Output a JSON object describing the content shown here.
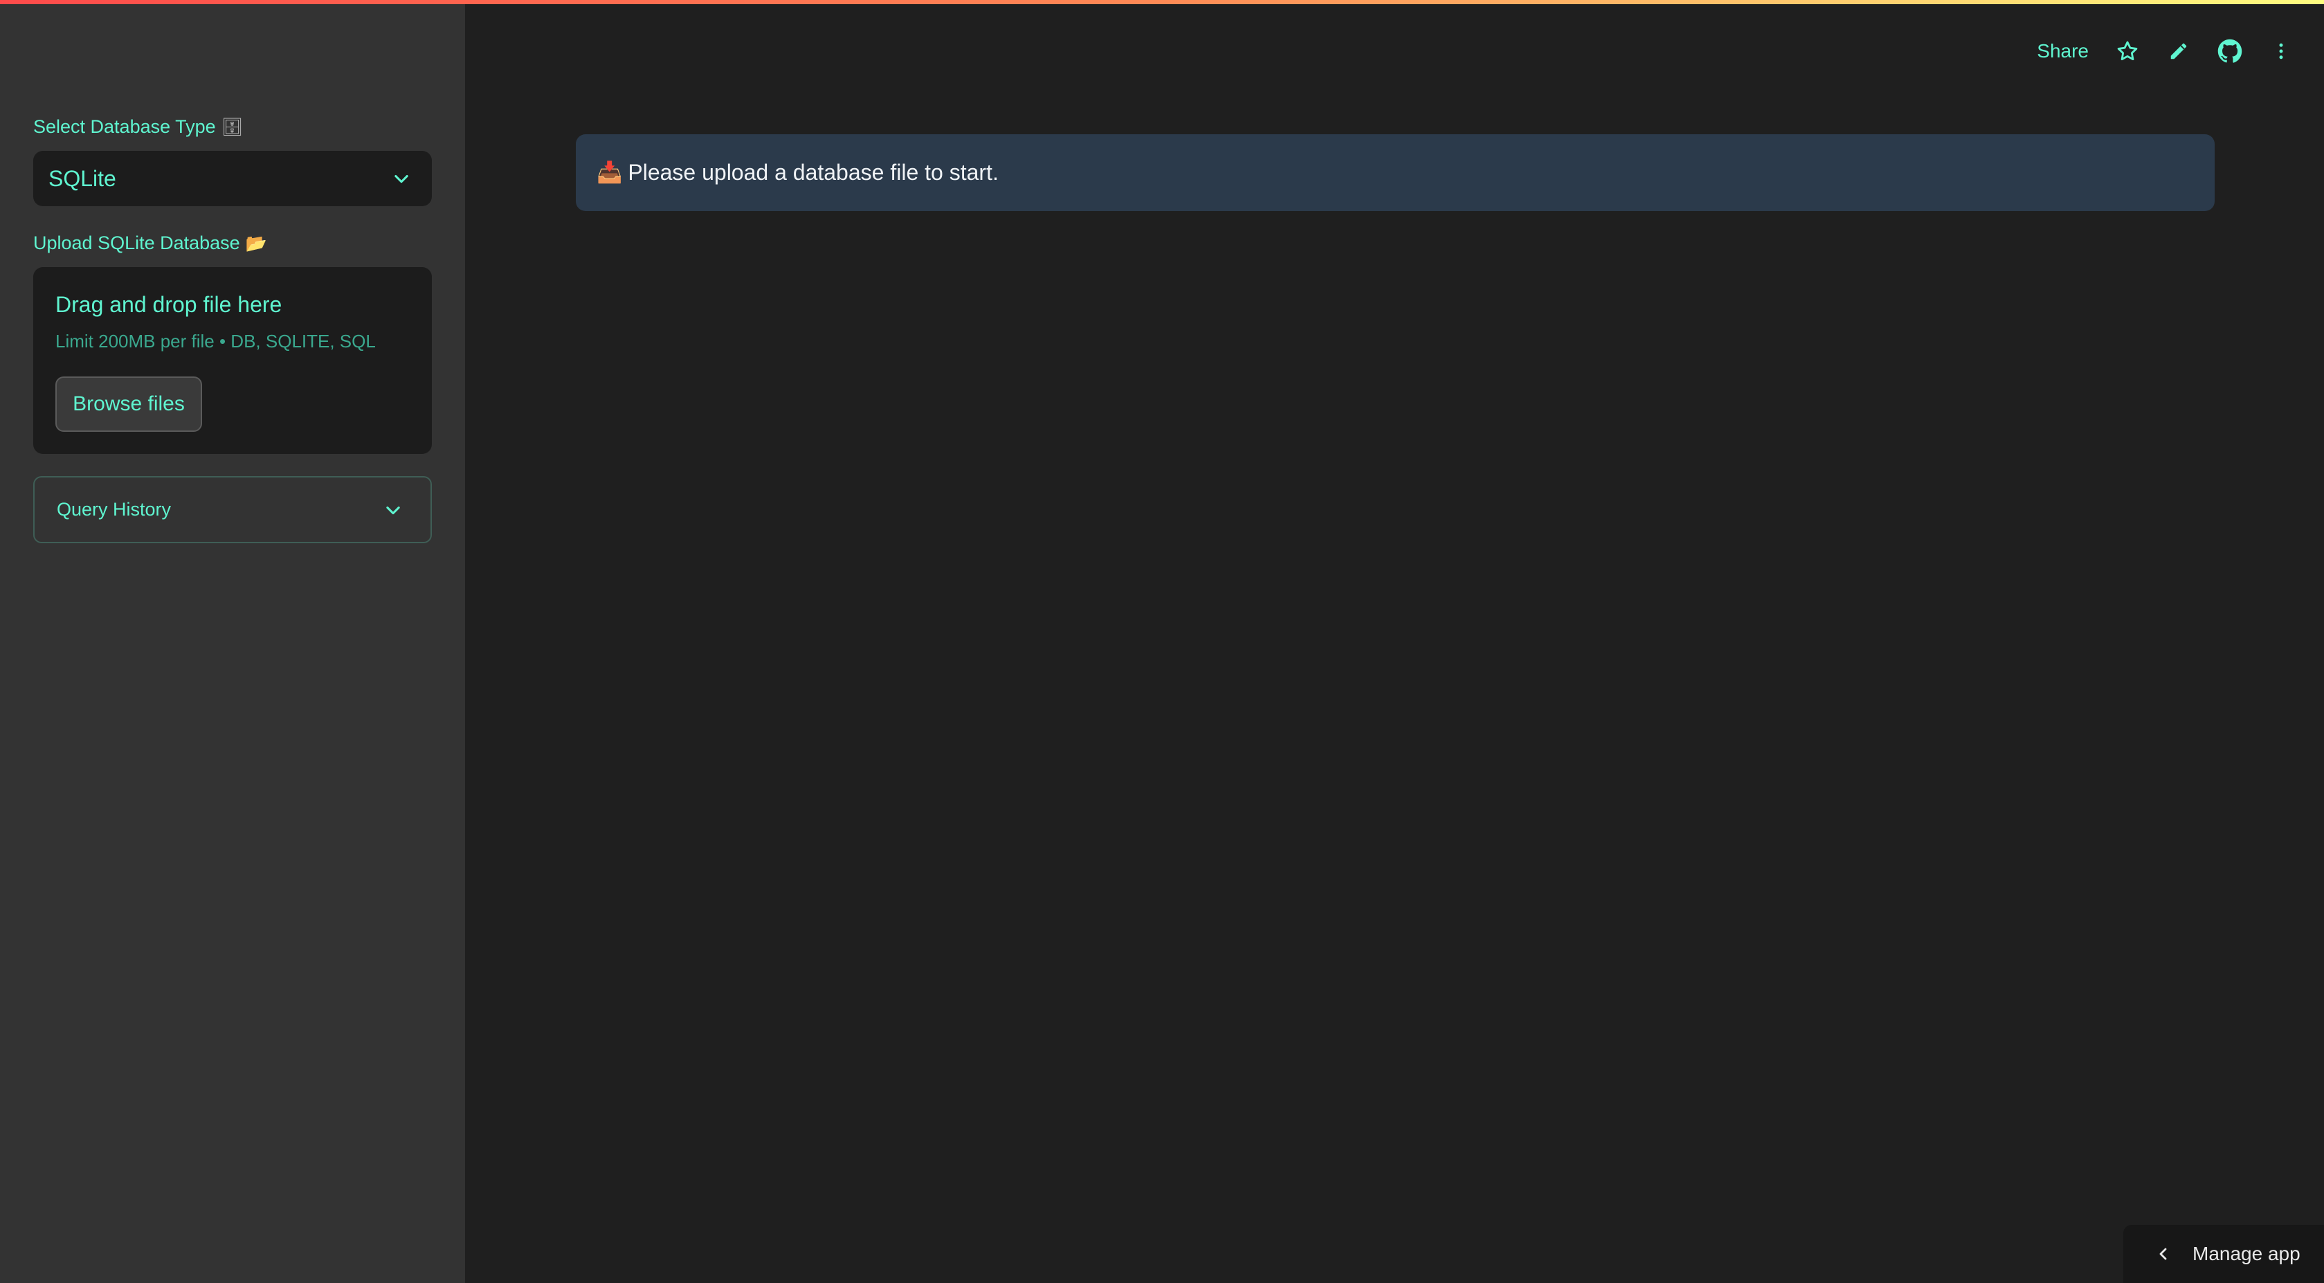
{
  "sidebar": {
    "db_type_label": "Select Database Type",
    "db_type_emoji": "🗄",
    "db_type_selected": "SQLite",
    "upload_label": "Upload SQLite Database",
    "upload_emoji": "📂",
    "uploader": {
      "title": "Drag and drop file here",
      "limit": "Limit 200MB per file • DB, SQLITE, SQL",
      "browse_label": "Browse files"
    },
    "query_history_label": "Query History"
  },
  "toolbar": {
    "share_label": "Share",
    "icons": [
      "star-icon",
      "pencil-icon",
      "github-icon",
      "more-vertical-icon"
    ]
  },
  "main": {
    "info_emoji": "📥",
    "info_message": "Please upload a database file to start."
  },
  "manage_app_label": "Manage app",
  "colors": {
    "accent": "#5ff5d0",
    "sidebar_bg": "#333333",
    "main_bg": "#1f1f1f",
    "info_bg": "#2b3a4b"
  }
}
